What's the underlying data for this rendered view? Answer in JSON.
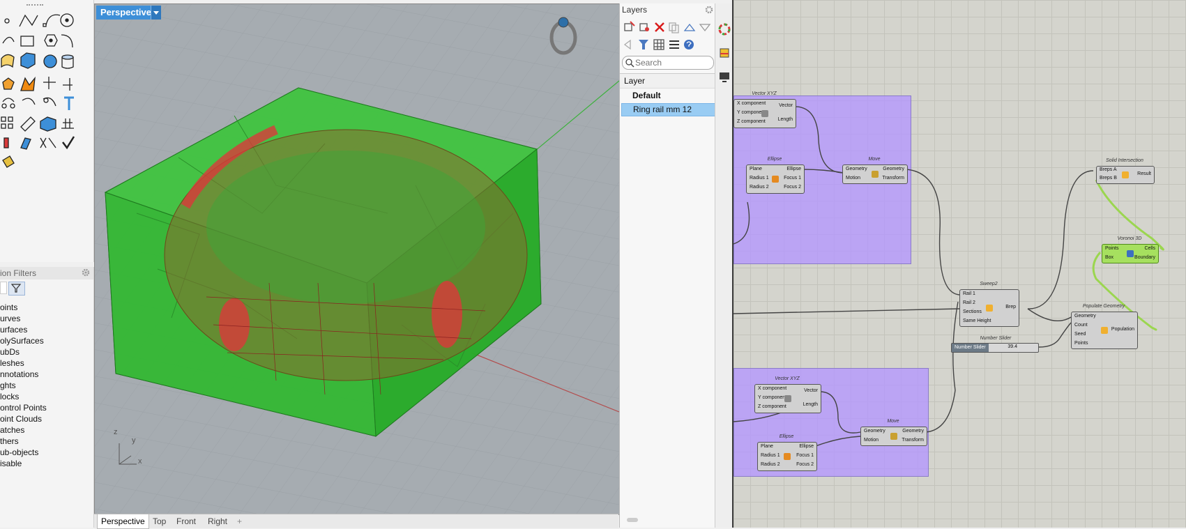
{
  "viewport": {
    "title": "Perspective",
    "axes": {
      "x": "x",
      "y": "y",
      "z": "z"
    },
    "tabs": [
      "Perspective",
      "Top",
      "Front",
      "Right"
    ],
    "add_tab_glyph": "+",
    "colors": {
      "background": "#a6acb1",
      "box": "#2eb82e",
      "ring": "#8b6a2e",
      "ellipse": "#d93a3a"
    }
  },
  "toolbar": {
    "icons": [
      "point-icon",
      "polyline-icon",
      "curve-icon",
      "circle-icon",
      "arc-icon",
      "rectangle-icon",
      "polygon-icon",
      "fillet-curve-icon",
      "surface-icon",
      "box-icon",
      "sphere-icon",
      "cylinder-icon",
      "gear-icon",
      "explode-icon",
      "trim-icon",
      "extend-icon",
      "join-icon",
      "rotate-icon",
      "scale-icon",
      "text-icon",
      "array-icon",
      "edit-icon",
      "cage-icon",
      "grid-icon",
      "analyze-icon",
      "render-icon",
      "mesh-icon",
      "check-icon",
      "paint-icon"
    ]
  },
  "filters": {
    "header": "ion Filters",
    "items": [
      "oints",
      "urves",
      "urfaces",
      "olySurfaces",
      "ubDs",
      "leshes",
      "nnotations",
      "ghts",
      "locks",
      "ontrol Points",
      "oint Clouds",
      "atches",
      "thers",
      "ub-objects",
      "isable"
    ]
  },
  "layers": {
    "title": "Layers",
    "search_placeholder": "Search",
    "column_header": "Layer",
    "rows": [
      {
        "name": "Default",
        "current": true,
        "selected": false
      },
      {
        "name": "Ring rail mm 12",
        "current": false,
        "selected": true
      }
    ],
    "toolbar_icons": [
      "new-layer-icon",
      "new-sublayer-icon",
      "delete-icon",
      "copy-icon",
      "move-up-icon",
      "move-down-icon",
      "move-left-icon",
      "filter-icon",
      "table-icon",
      "menu-icon",
      "help-icon"
    ]
  },
  "grasshopper": {
    "components": [
      {
        "id": "vec1",
        "title": "Vector XYZ",
        "inputs": [
          "X component",
          "Y component",
          "Z component"
        ],
        "outputs": [
          "Vector",
          "Length"
        ]
      },
      {
        "id": "ell1",
        "title": "Ellipse",
        "inputs": [
          "Plane",
          "Radius 1",
          "Radius 2"
        ],
        "outputs": [
          "Ellipse",
          "Focus 1",
          "Focus 2"
        ]
      },
      {
        "id": "mov1",
        "title": "Move",
        "inputs": [
          "Geometry",
          "Motion"
        ],
        "outputs": [
          "Geometry",
          "Transform"
        ]
      },
      {
        "id": "sol",
        "title": "Solid Intersection",
        "inputs": [
          "Breps A",
          "Breps B"
        ],
        "outputs": [
          "Result"
        ]
      },
      {
        "id": "vor",
        "title": "Voronoi 3D",
        "inputs": [
          "Points",
          "Box"
        ],
        "outputs": [
          "Cells",
          "Boundary"
        ]
      },
      {
        "id": "swp",
        "title": "Sweep2",
        "inputs": [
          "Rail 1",
          "Rail 2",
          "Sections",
          "Same Height"
        ],
        "outputs": [
          "Brep"
        ]
      },
      {
        "id": "pop",
        "title": "Populate Geometry",
        "inputs": [
          "Geometry",
          "Count",
          "Seed",
          "Points"
        ],
        "outputs": [
          "Population"
        ]
      },
      {
        "id": "vec2",
        "title": "Vector XYZ",
        "inputs": [
          "X component",
          "Y component",
          "Z component"
        ],
        "outputs": [
          "Vector",
          "Length"
        ]
      },
      {
        "id": "ell2",
        "title": "Ellipse",
        "inputs": [
          "Plane",
          "Radius 1",
          "Radius 2"
        ],
        "outputs": [
          "Ellipse",
          "Focus 1",
          "Focus 2"
        ]
      },
      {
        "id": "mov2",
        "title": "Move",
        "inputs": [
          "Geometry",
          "Motion"
        ],
        "outputs": [
          "Geometry",
          "Transform"
        ]
      }
    ],
    "slider": {
      "title": "Number Slider",
      "name": "Number Slider",
      "value": "39.4"
    }
  }
}
